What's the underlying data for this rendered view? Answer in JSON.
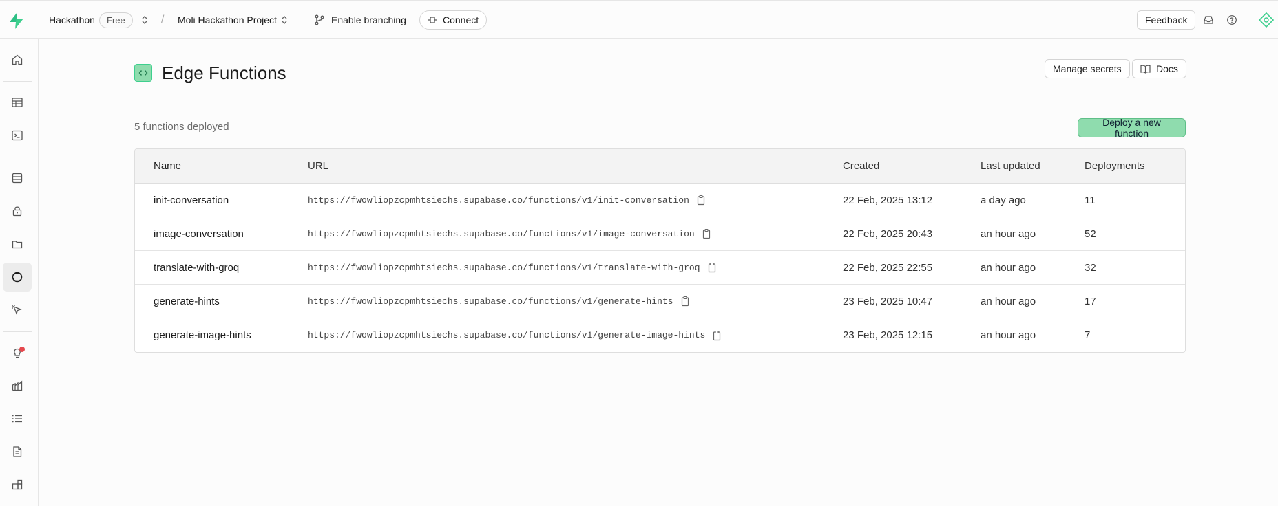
{
  "topbar": {
    "org": "Hackathon",
    "plan": "Free",
    "project": "Moli Hackathon Project",
    "branching": "Enable branching",
    "connect": "Connect",
    "feedback": "Feedback"
  },
  "page": {
    "title": "Edge Functions",
    "manage_secrets": "Manage secrets",
    "docs": "Docs",
    "count_text": "5 functions deployed",
    "deploy_button": "Deploy a new function"
  },
  "table": {
    "headers": {
      "name": "Name",
      "url": "URL",
      "created": "Created",
      "updated": "Last updated",
      "deployments": "Deployments"
    },
    "rows": [
      {
        "name": "init-conversation",
        "url": "https://fwowliopzcpmhtsiechs.supabase.co/functions/v1/init-conversation",
        "created": "22 Feb, 2025 13:12",
        "updated": "a day ago",
        "deployments": "11"
      },
      {
        "name": "image-conversation",
        "url": "https://fwowliopzcpmhtsiechs.supabase.co/functions/v1/image-conversation",
        "created": "22 Feb, 2025 20:43",
        "updated": "an hour ago",
        "deployments": "52"
      },
      {
        "name": "translate-with-groq",
        "url": "https://fwowliopzcpmhtsiechs.supabase.co/functions/v1/translate-with-groq",
        "created": "22 Feb, 2025 22:55",
        "updated": "an hour ago",
        "deployments": "32"
      },
      {
        "name": "generate-hints",
        "url": "https://fwowliopzcpmhtsiechs.supabase.co/functions/v1/generate-hints",
        "created": "23 Feb, 2025 10:47",
        "updated": "an hour ago",
        "deployments": "17"
      },
      {
        "name": "generate-image-hints",
        "url": "https://fwowliopzcpmhtsiechs.supabase.co/functions/v1/generate-image-hints",
        "created": "23 Feb, 2025 12:15",
        "updated": "an hour ago",
        "deployments": "7"
      }
    ]
  },
  "colors": {
    "brand": "#3ecf8e",
    "button_green": "#8fdcae",
    "notification": "#e5484d"
  },
  "icons": {
    "sidebar": [
      "home-icon",
      "table-editor-icon",
      "sql-editor-icon",
      "database-icon",
      "auth-icon",
      "storage-icon",
      "edge-functions-icon",
      "realtime-icon",
      "advisors-icon",
      "reports-icon",
      "logs-icon",
      "api-docs-icon",
      "integrations-icon"
    ]
  }
}
